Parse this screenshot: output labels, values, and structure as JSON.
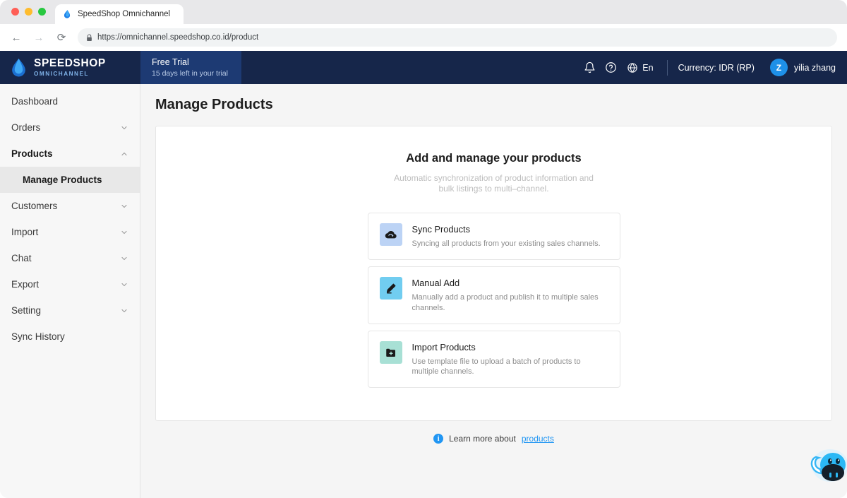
{
  "browser": {
    "tab_title": "SpeedShop Omnichannel",
    "tab_favicon_name": "speedshop-drop-favicon",
    "back_label": "←",
    "forward_label": "→",
    "reload_label": "⟳",
    "url": "https://omnichannel.speedshop.co.id/product"
  },
  "header": {
    "brand_name": "SPEEDSHOP",
    "brand_sub": "OMNICHANNEL",
    "trial_title": "Free Trial",
    "trial_sub": "15 days left in your trial",
    "notification_icon": "bell-icon",
    "help_icon": "question-circle-icon",
    "language_icon": "globe-icon",
    "language": "En",
    "currency": "Currency: IDR (RP)",
    "avatar_initial": "Z",
    "username": "yilia zhang",
    "bar_color": "#16264a",
    "trial_color": "#1d3a73",
    "avatar_color": "#1e90e8"
  },
  "sidebar": {
    "items": [
      {
        "label": "Dashboard",
        "expandable": false,
        "state": ""
      },
      {
        "label": "Orders",
        "expandable": true,
        "state": "collapsed"
      },
      {
        "label": "Products",
        "expandable": true,
        "state": "expanded"
      },
      {
        "label": "Customers",
        "expandable": true,
        "state": "collapsed"
      },
      {
        "label": "Import",
        "expandable": true,
        "state": "collapsed"
      },
      {
        "label": "Chat",
        "expandable": true,
        "state": "collapsed"
      },
      {
        "label": "Export",
        "expandable": true,
        "state": "collapsed"
      },
      {
        "label": "Setting",
        "expandable": true,
        "state": "collapsed"
      },
      {
        "label": "Sync History",
        "expandable": false,
        "state": ""
      }
    ],
    "active_sub_item": "Manage Products"
  },
  "main": {
    "page_title": "Manage Products",
    "panel_title": "Add and manage your products",
    "panel_subtitle_line1": "Automatic synchronization of product information and",
    "panel_subtitle_line2": "bulk listings to multi–channel.",
    "options": [
      {
        "title": "Sync Products",
        "desc": "Syncing all products from your existing sales channels.",
        "icon": "cloud-sync-icon",
        "tile_color": "#bcd3f5"
      },
      {
        "title": "Manual Add",
        "desc": "Manually add a product and publish it to multiple sales channels.",
        "icon": "pencil-icon",
        "tile_color": "#71cdf0"
      },
      {
        "title": "Import Products",
        "desc": "Use template file to upload a batch of products to multiple channels.",
        "icon": "folder-plus-icon",
        "tile_color": "#a8e0d5"
      }
    ],
    "learn_more_prefix": "Learn more about",
    "learn_more_link": "products",
    "info_icon": "info-icon",
    "link_color": "#2196f3"
  },
  "chat": {
    "widget_icon": "chat-mascot-icon"
  }
}
